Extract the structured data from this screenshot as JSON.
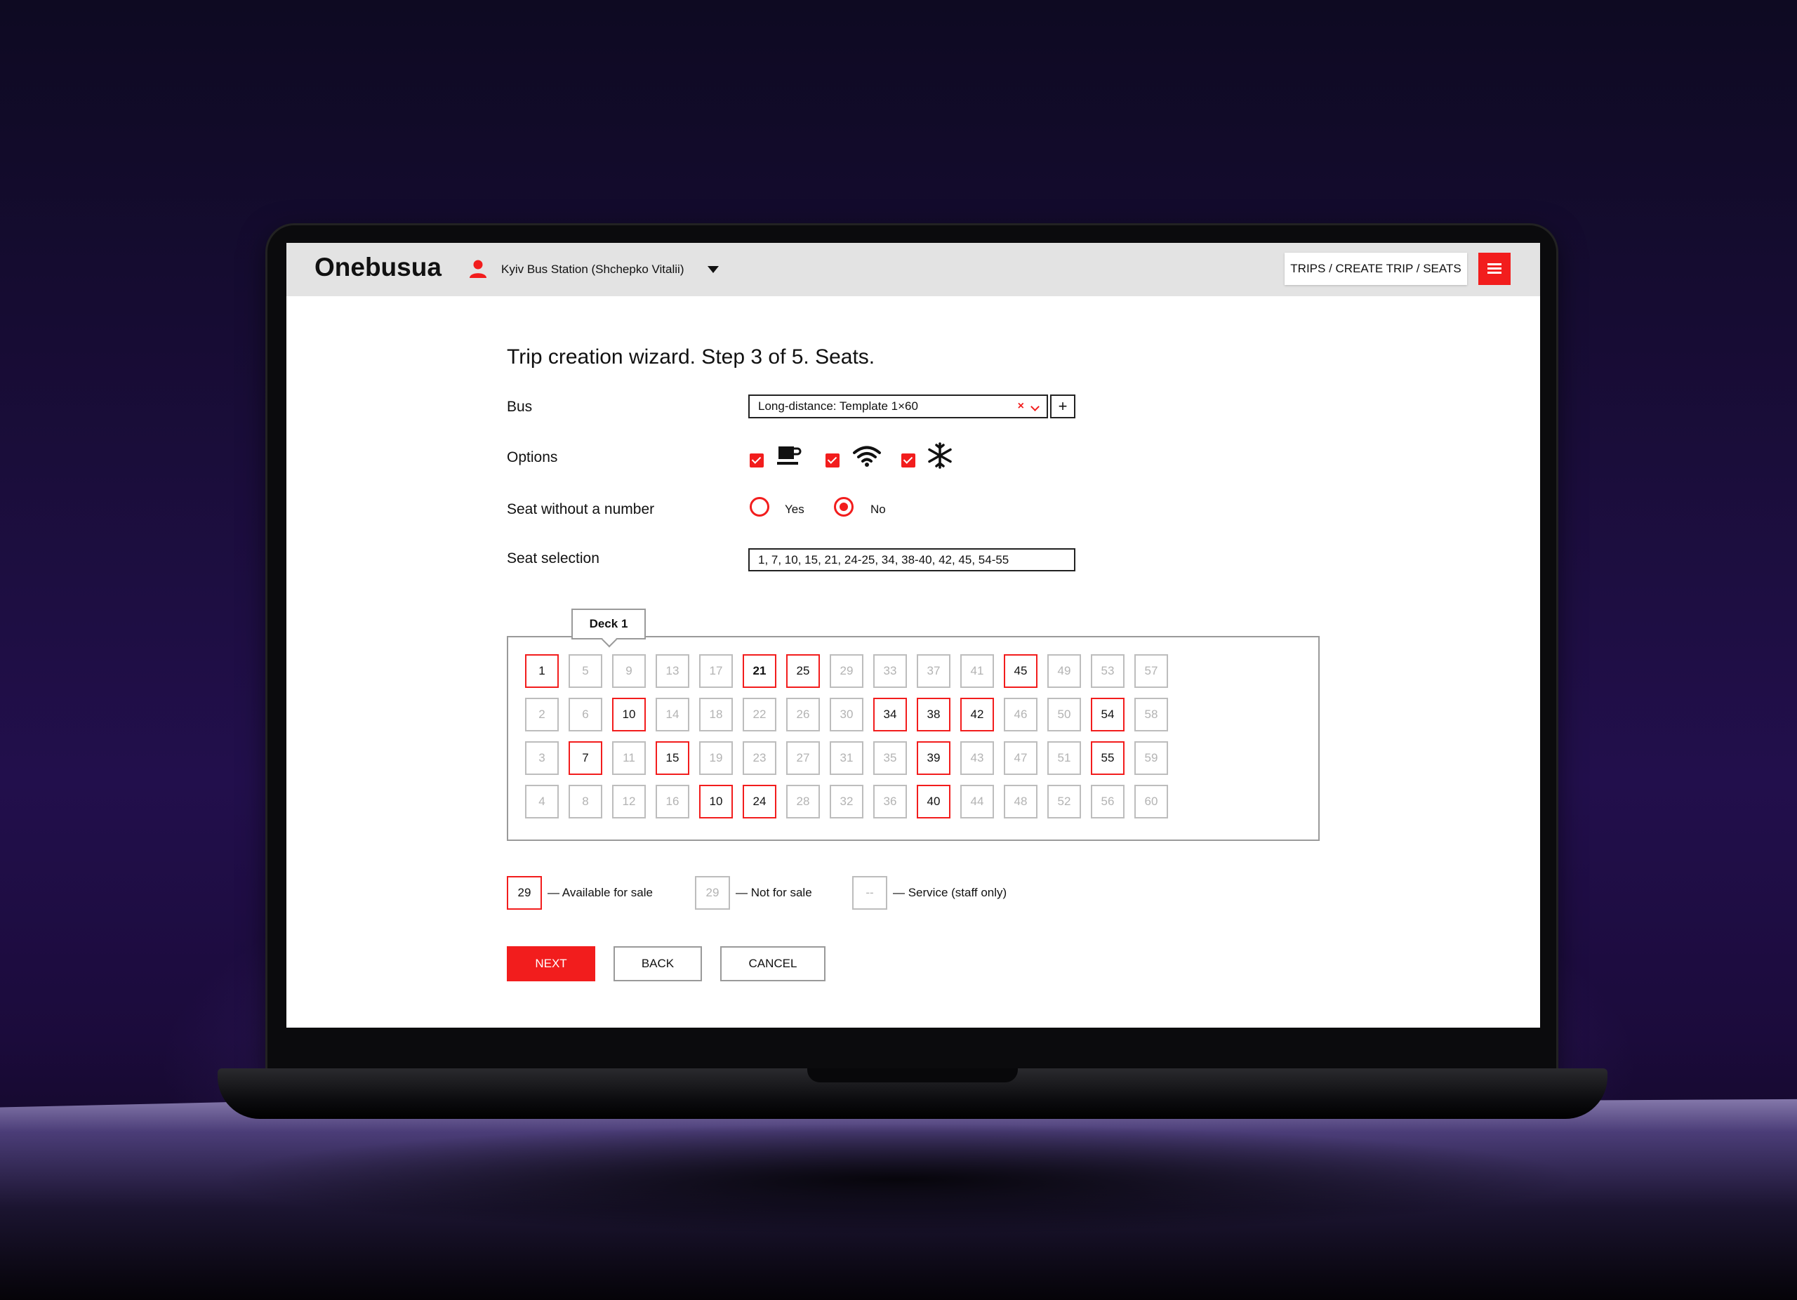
{
  "app": {
    "name": "Onebusua"
  },
  "header": {
    "station": "Kyiv Bus Station (Shchepko Vitalii)",
    "breadcrumb": "TRIPS / CREATE TRIP / SEATS"
  },
  "page": {
    "title": "Trip creation wizard. Step 3 of 5. Seats."
  },
  "form": {
    "bus_label": "Bus",
    "bus_value": "Long-distance: Template 1×60",
    "bus_clear": "×",
    "bus_add": "+",
    "options_label": "Options",
    "options": [
      {
        "icon": "coffee-icon",
        "checked": true
      },
      {
        "icon": "wifi-icon",
        "checked": true
      },
      {
        "icon": "snowflake-icon",
        "checked": true
      }
    ],
    "seat_without_number_label": "Seat without a number",
    "radio_yes": "Yes",
    "radio_no": "No",
    "radio_selected": "No",
    "seat_selection_label": "Seat selection",
    "seat_selection_value": "1, 7, 10, 15, 21, 24-25, 34, 38-40, 42, 45, 54-55"
  },
  "deck": {
    "tab": "Deck 1",
    "rows": [
      [
        "1",
        "5",
        "9",
        "13",
        "17",
        "21",
        "25",
        "29",
        "33",
        "37",
        "41",
        "45",
        "49",
        "53",
        "57"
      ],
      [
        "2",
        "6",
        "10",
        "14",
        "18",
        "22",
        "26",
        "30",
        "34",
        "38",
        "42",
        "46",
        "50",
        "54",
        "58"
      ],
      [
        "3",
        "7",
        "11",
        "15",
        "19",
        "23",
        "27",
        "31",
        "35",
        "39",
        "43",
        "47",
        "51",
        "55",
        "59"
      ],
      [
        "4",
        "8",
        "12",
        "16",
        "10",
        "24",
        "28",
        "32",
        "36",
        "40",
        "44",
        "48",
        "52",
        "56",
        "60"
      ]
    ],
    "available": [
      "1",
      "7",
      "10",
      "15",
      "21",
      "24",
      "25",
      "34",
      "38",
      "39",
      "40",
      "42",
      "45",
      "54",
      "55"
    ],
    "bold": [
      "21"
    ]
  },
  "legend": {
    "available_sample": "29",
    "available_text": "— Available for sale",
    "not_sale_sample": "29",
    "not_sale_text": "— Not for sale",
    "service_sample": "--",
    "service_text": "— Service (staff only)"
  },
  "buttons": {
    "next": "NEXT",
    "back": "BACK",
    "cancel": "CANCEL"
  },
  "colors": {
    "accent": "#f21d1d",
    "header_bg": "#e3e3e3"
  }
}
